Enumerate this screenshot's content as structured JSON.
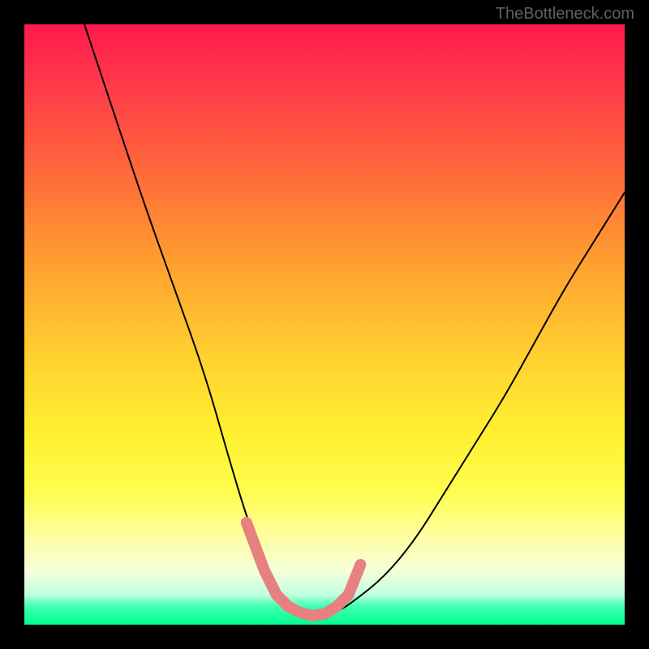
{
  "watermark": "TheBottleneck.com",
  "chart_data": {
    "type": "line",
    "title": "",
    "xlabel": "",
    "ylabel": "",
    "xlim": [
      0,
      100
    ],
    "ylim": [
      0,
      100
    ],
    "series": [
      {
        "name": "bottleneck-curve",
        "x_percent": [
          10,
          15,
          20,
          25,
          30,
          34,
          37,
          40,
          42,
          44,
          48,
          52,
          55,
          60,
          65,
          70,
          75,
          80,
          85,
          90,
          95,
          100
        ],
        "y_percent": [
          100,
          85,
          70,
          56,
          42,
          28,
          18,
          10,
          6,
          3,
          1.5,
          2,
          4,
          8,
          14,
          22,
          30,
          38,
          47,
          56,
          64,
          72
        ]
      }
    ],
    "annotations": [
      {
        "name": "red-trough-marker",
        "type": "path",
        "x_percent": [
          37,
          40,
          42,
          44,
          46,
          48,
          50,
          52,
          54,
          56
        ],
        "y_percent": [
          17,
          9,
          5,
          3,
          2,
          1.5,
          1.8,
          3,
          5,
          10
        ],
        "color": "#e87878"
      }
    ],
    "gradient_stops": [
      {
        "pos": 0,
        "color": "#ff1a4d"
      },
      {
        "pos": 50,
        "color": "#ffd030"
      },
      {
        "pos": 80,
        "color": "#fffd50"
      },
      {
        "pos": 100,
        "color": "#00ff90"
      }
    ]
  }
}
